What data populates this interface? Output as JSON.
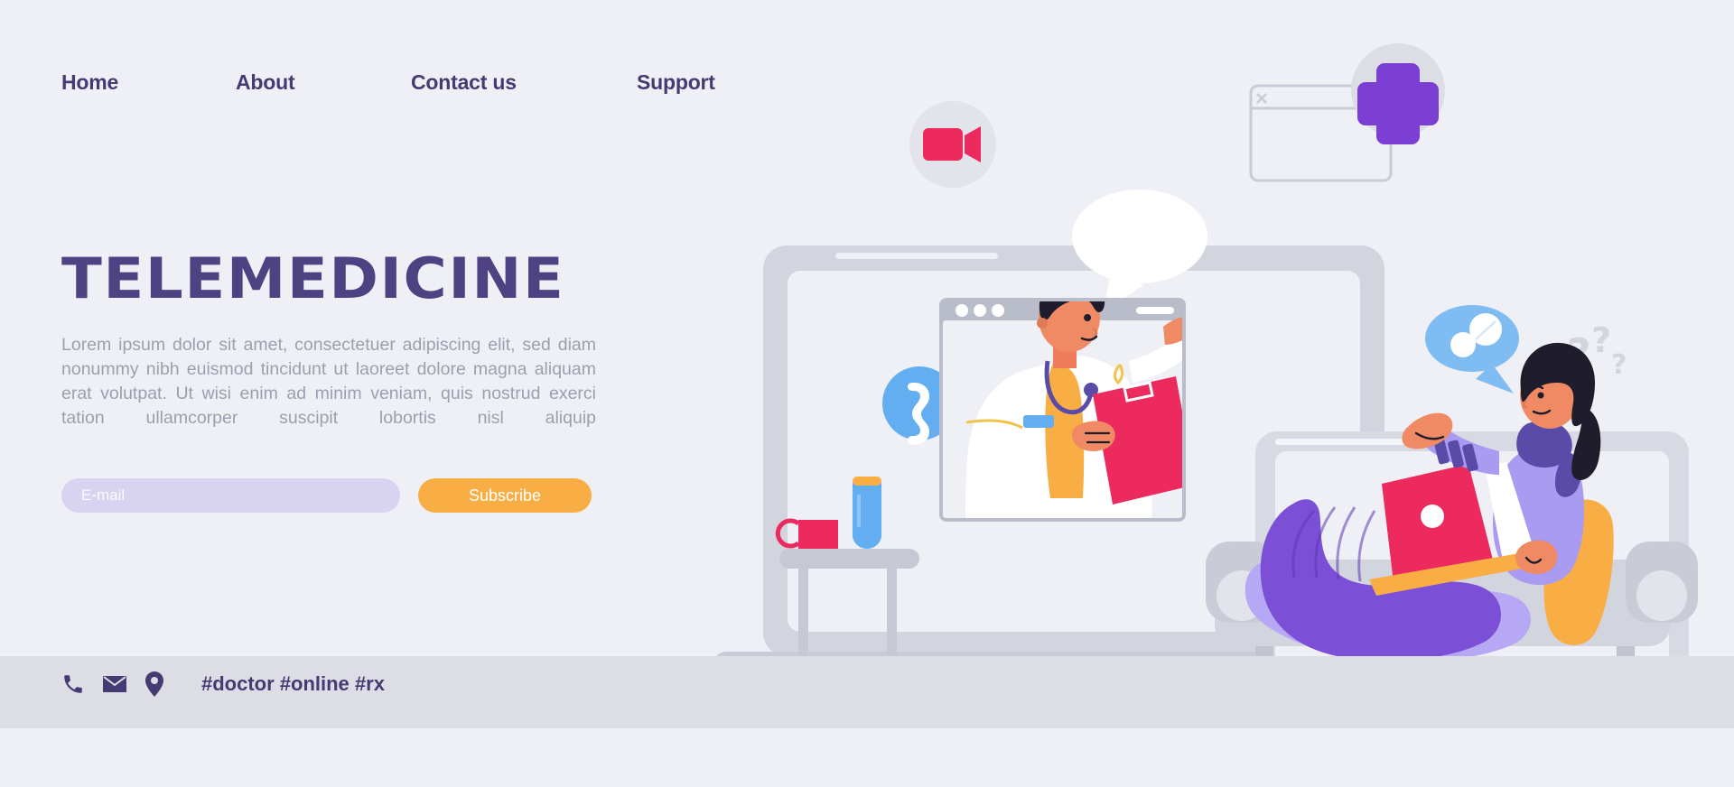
{
  "nav": {
    "items": [
      {
        "label": "Home",
        "name": "nav-item-home"
      },
      {
        "label": "About",
        "name": "nav-item-about"
      },
      {
        "label": "Contact us",
        "name": "nav-item-contact-us"
      },
      {
        "label": "Support",
        "name": "nav-item-support"
      }
    ]
  },
  "hero": {
    "title": "TELEMEDICINE",
    "paragraph": "Lorem ipsum dolor sit amet, consectetuer adipiscing elit, sed diam nonummy nibh euismod tincidunt ut laoreet dolore magna aliquam erat volutpat. Ut wisi enim ad minim veniam, quis nostrud exerci tation ullamcorper suscipit lobortis nisl aliquip"
  },
  "form": {
    "email_placeholder": "E-mail",
    "email_value": "",
    "subscribe_label": "Subscribe"
  },
  "footer": {
    "icons": [
      "phone-icon",
      "envelope-icon",
      "location-pin-icon"
    ],
    "hashtags": "#doctor #online #rx"
  },
  "illustration": {
    "video_camera_badge": "video-camera-icon",
    "browser_window_close": "close-icon",
    "medical_cross_badge": "medical-cross-icon",
    "phone_call_badge": "phone-handset-icon",
    "speech_bubble": "speech-bubble",
    "pill_bubble": "pill-icon",
    "question_marks": "??",
    "laptop_left": "laptop-device",
    "laptop_right": "laptop-device",
    "doctor": "doctor-avatar",
    "patient": "patient-avatar",
    "side_table_items": [
      "mug",
      "water-bottle"
    ]
  },
  "colors": {
    "background": "#eff0f5",
    "footer_bar": "#dcdde5",
    "heading_purple": "#4e4283",
    "nav_purple": "#463a73",
    "body_gray": "#9aa0ae",
    "input_lavender": "#d7d3f0",
    "accent_orange": "#f9ae45",
    "accent_pink": "#ec2a5e",
    "accent_blue": "#63aef0",
    "accent_violet": "#7b3fd4",
    "device_gray": "#c9cbd6"
  }
}
